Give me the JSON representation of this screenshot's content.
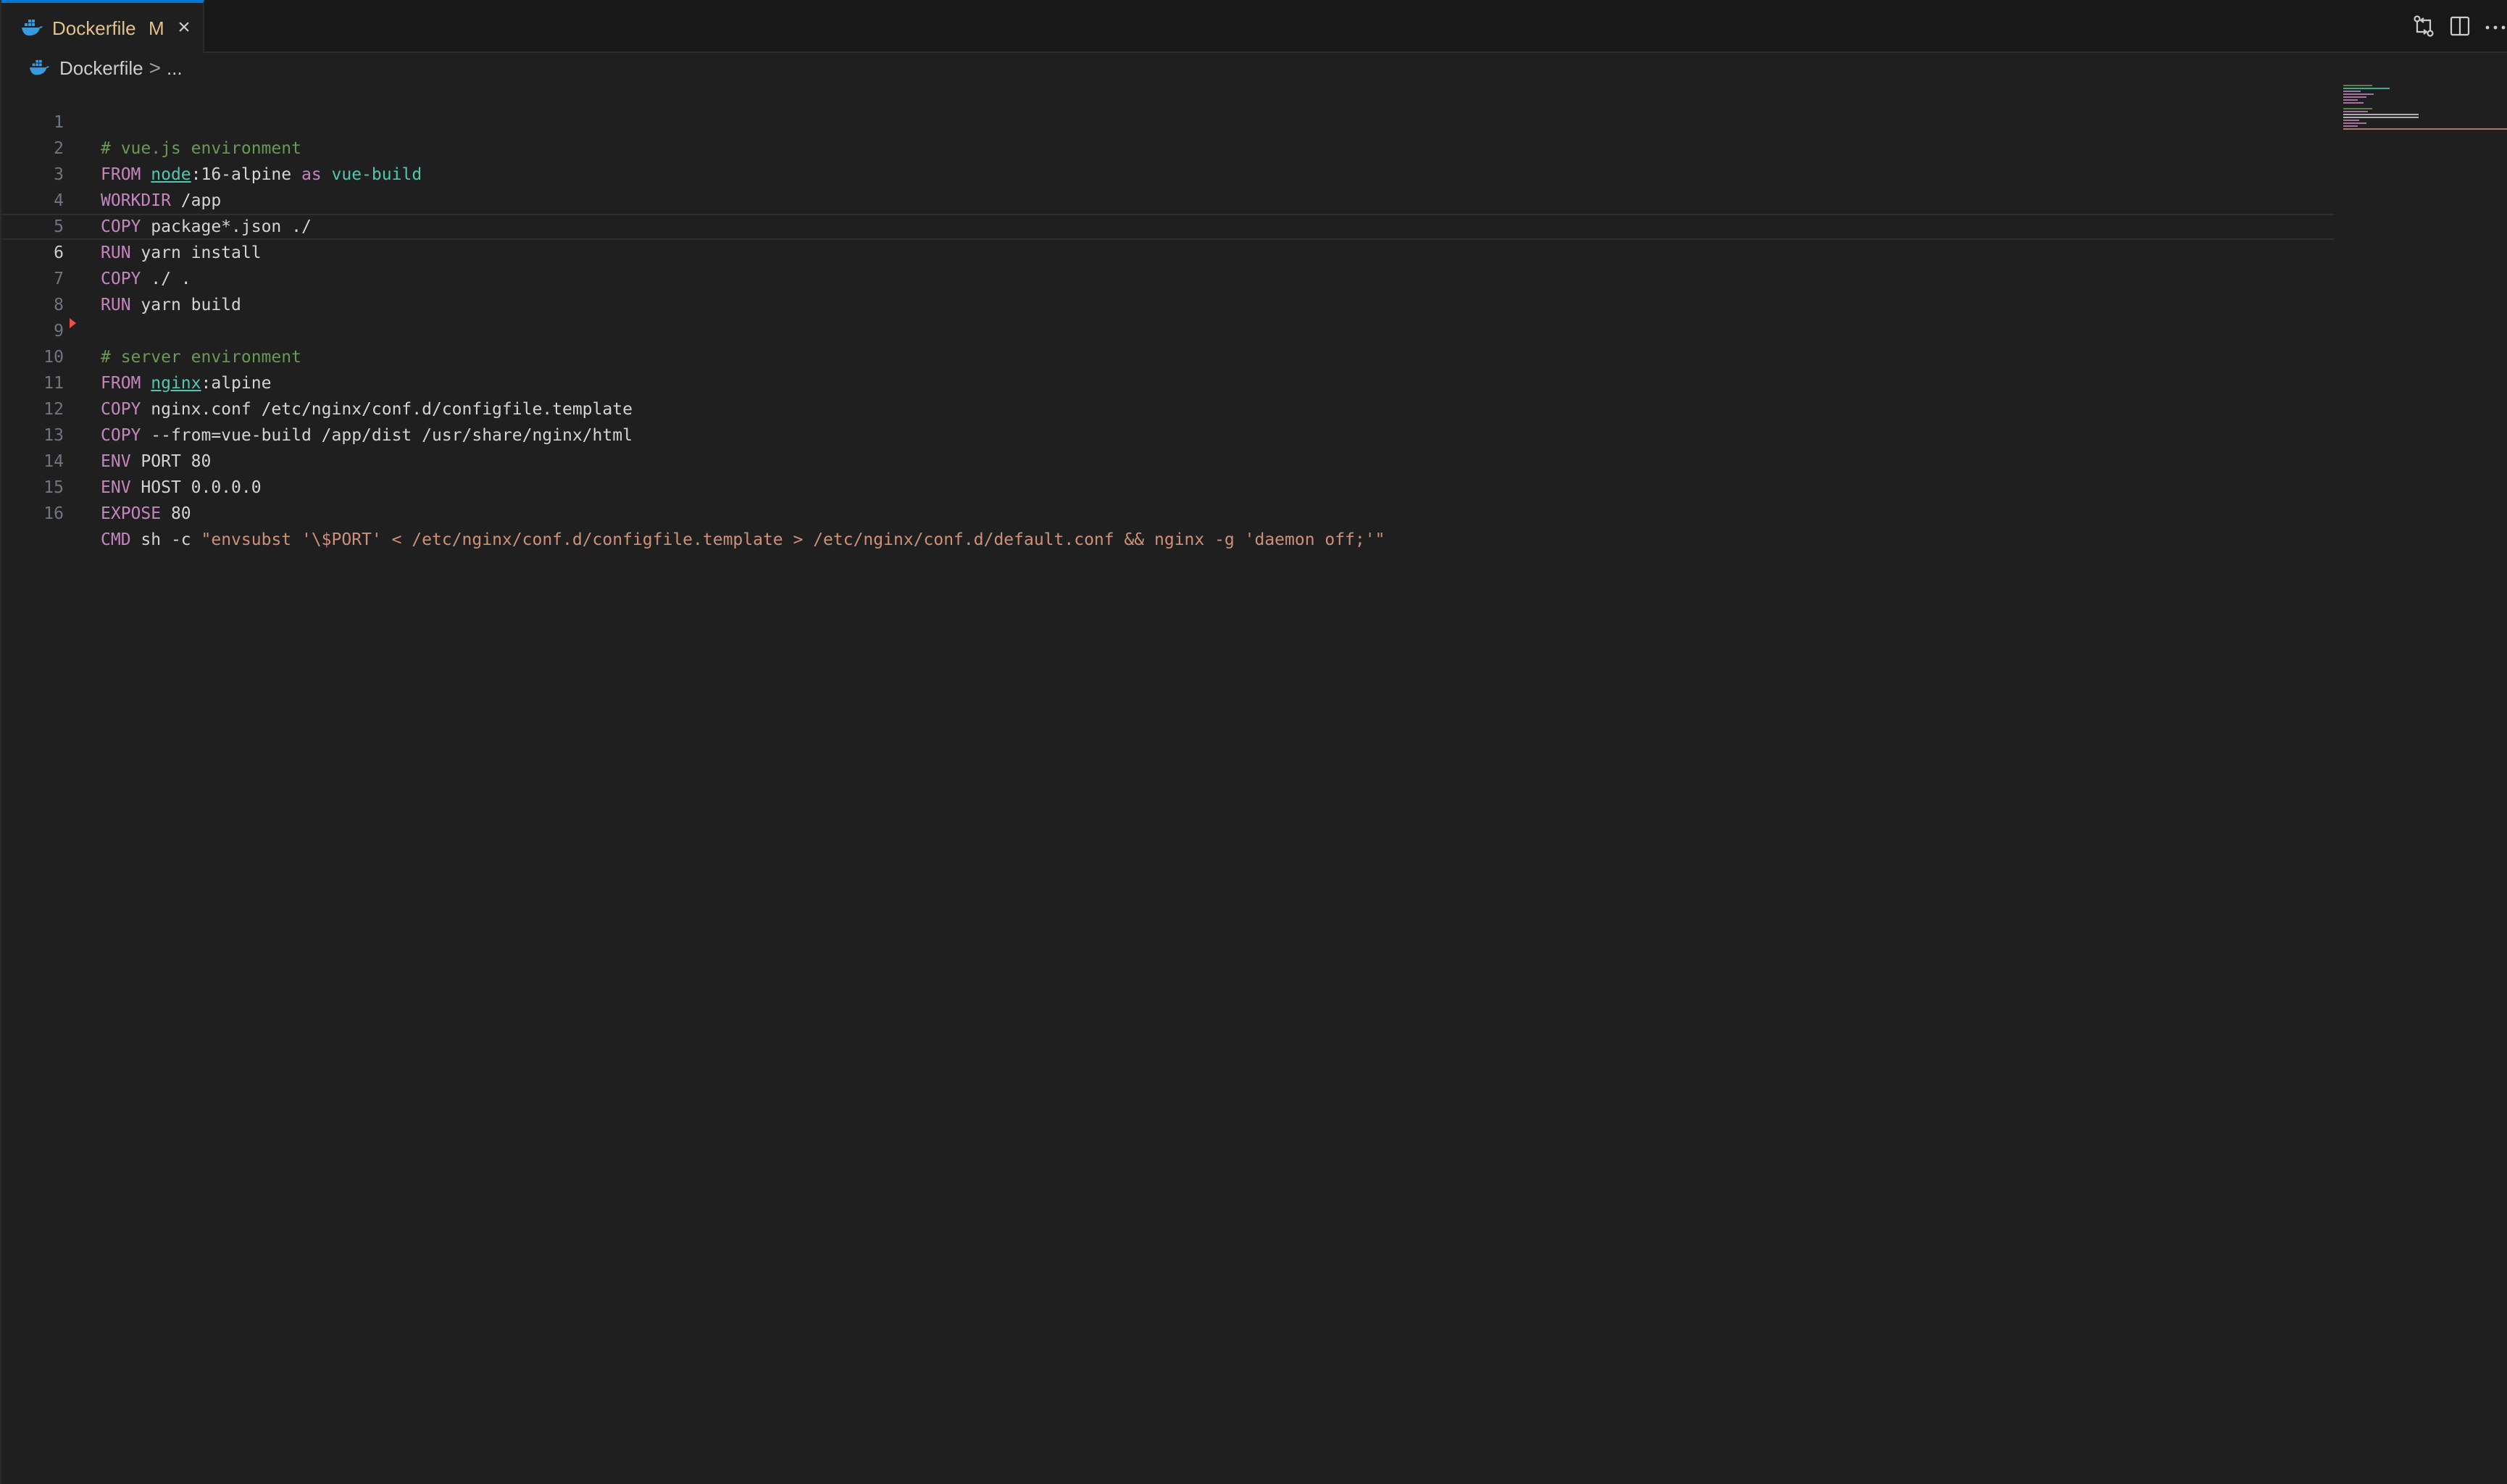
{
  "tabs": [
    {
      "name": "Dockerfile",
      "status": "M",
      "icon": "docker-whale-icon",
      "active": true
    }
  ],
  "tab_actions": [
    {
      "icon": "open-changes-icon"
    },
    {
      "icon": "split-editor-icon"
    },
    {
      "icon": "more-actions-icon",
      "label": "···"
    }
  ],
  "breadcrumb": {
    "file": "Dockerfile",
    "separator": ">",
    "symbol": "..."
  },
  "editor": {
    "current_line": 6,
    "lines": [
      {
        "num": "1",
        "text": "# vue.js environment"
      },
      {
        "num": "2",
        "text": "FROM node:16-alpine as vue-build"
      },
      {
        "num": "3",
        "text": "WORKDIR /app"
      },
      {
        "num": "4",
        "text": "COPY package*.json ./"
      },
      {
        "num": "5",
        "text": "RUN yarn install"
      },
      {
        "num": "6",
        "text": "COPY ./ ."
      },
      {
        "num": "7",
        "text": "RUN yarn build"
      },
      {
        "num": "8",
        "text": ""
      },
      {
        "num": "9",
        "text": "# server environment"
      },
      {
        "num": "10",
        "text": "FROM nginx:alpine"
      },
      {
        "num": "11",
        "text": "COPY nginx.conf /etc/nginx/conf.d/configfile.template"
      },
      {
        "num": "12",
        "text": "COPY --from=vue-build /app/dist /usr/share/nginx/html"
      },
      {
        "num": "13",
        "text": "ENV PORT 80"
      },
      {
        "num": "14",
        "text": "ENV HOST 0.0.0.0"
      },
      {
        "num": "15",
        "text": "EXPOSE 80"
      },
      {
        "num": "16",
        "text": "CMD sh -c \"envsubst '\\$PORT' < /etc/nginx/conf.d/configfile.template > /etc/nginx/conf.d/default.conf && nginx -g 'daemon off;'\""
      }
    ]
  },
  "colors": {
    "keyword": "#c586c0",
    "comment": "#6a9955",
    "string": "#ce9178",
    "type": "#4ec9b0",
    "text": "#d4d4d4",
    "modified": "#e2c08d",
    "accent": "#0078d4",
    "dirty_marker": "#f14c4c"
  }
}
